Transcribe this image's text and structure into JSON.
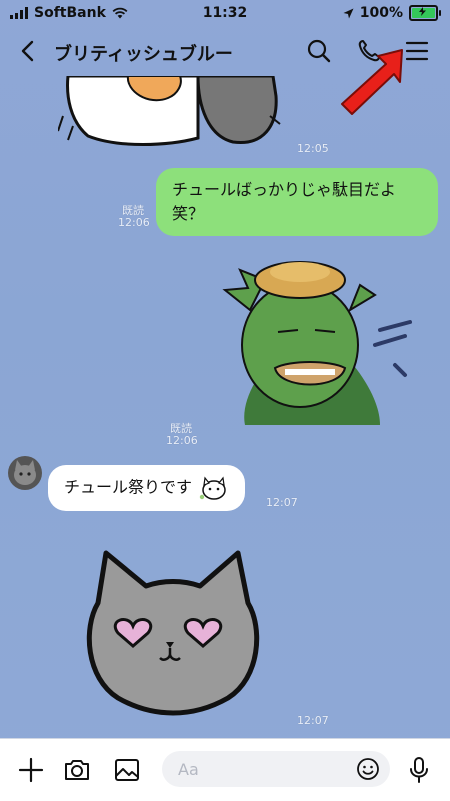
{
  "status_bar": {
    "carrier": "SoftBank",
    "time": "11:32",
    "battery": "100%"
  },
  "header": {
    "title": "ブリティッシュブルー"
  },
  "messages": [
    {
      "type": "sticker",
      "sender": "other",
      "icon": "cat-sticker-icon",
      "time": "12:05"
    },
    {
      "type": "text",
      "sender": "me",
      "text": "チュールばっかりじゃ駄目だよ笑？",
      "read": "既読",
      "time": "12:06"
    },
    {
      "type": "sticker",
      "sender": "me",
      "icon": "kappa-sticker-icon",
      "read": "既読",
      "time": "12:06"
    },
    {
      "type": "text",
      "sender": "other",
      "text": "チュール祭りです",
      "time": "12:07"
    },
    {
      "type": "sticker",
      "sender": "other",
      "icon": "heart-eyes-cat-sticker-icon",
      "time": "12:07"
    }
  ],
  "input": {
    "placeholder": "Aa"
  },
  "annotation": {
    "icon": "red-arrow-icon",
    "color": "#e8201a"
  }
}
